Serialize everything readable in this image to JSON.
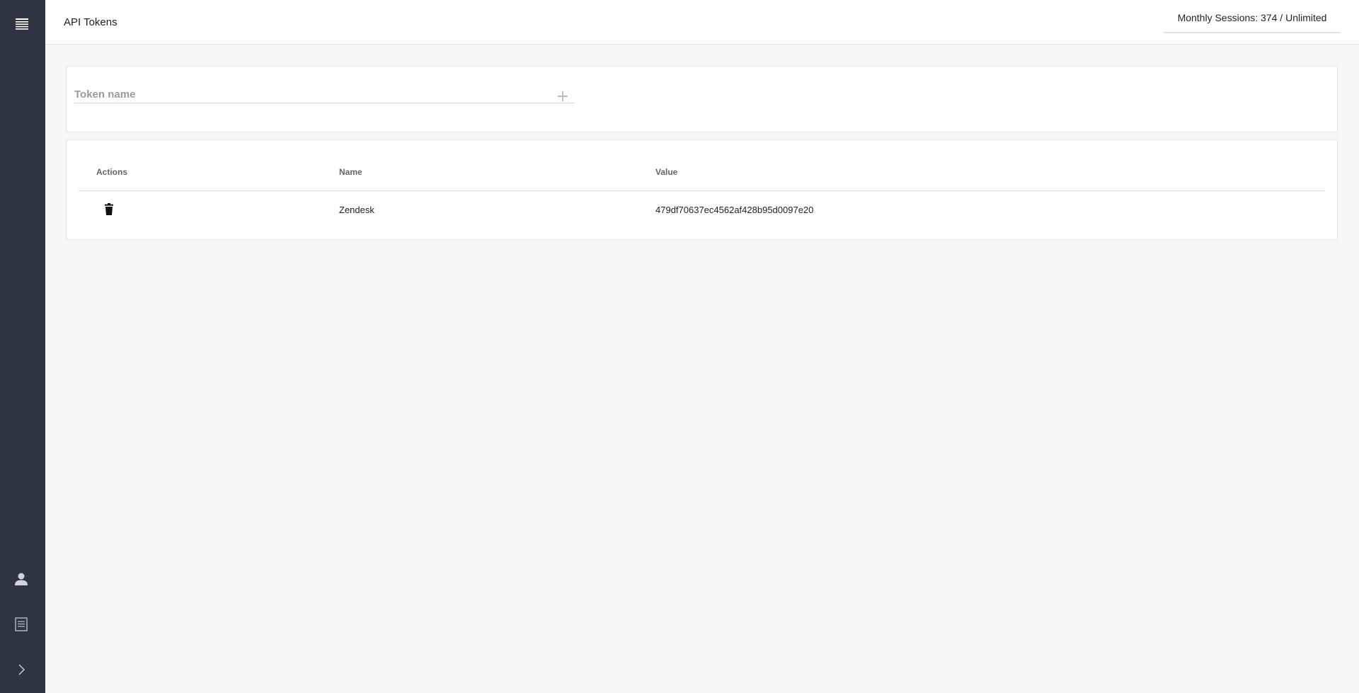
{
  "header": {
    "title": "API Tokens",
    "sessions_label": "Monthly Sessions: 374 / Unlimited"
  },
  "sidebar": {
    "top_icon": "menu-list-icon",
    "bottom_items": [
      {
        "icon": "user-icon"
      },
      {
        "icon": "document-icon"
      },
      {
        "icon": "chevron-right-icon"
      }
    ]
  },
  "form": {
    "placeholder": "Token name",
    "value": "",
    "add_icon": "plus-icon"
  },
  "table": {
    "columns": [
      "Actions",
      "Name",
      "Value"
    ],
    "rows": [
      {
        "action_icon": "trash-icon",
        "name": "Zendesk",
        "value": "479df70637ec4562af428b95d0097e20"
      }
    ]
  },
  "colors": {
    "sidebar_bg": "#2e3440",
    "page_bg": "#f7f7f7",
    "card_bg": "#ffffff"
  }
}
